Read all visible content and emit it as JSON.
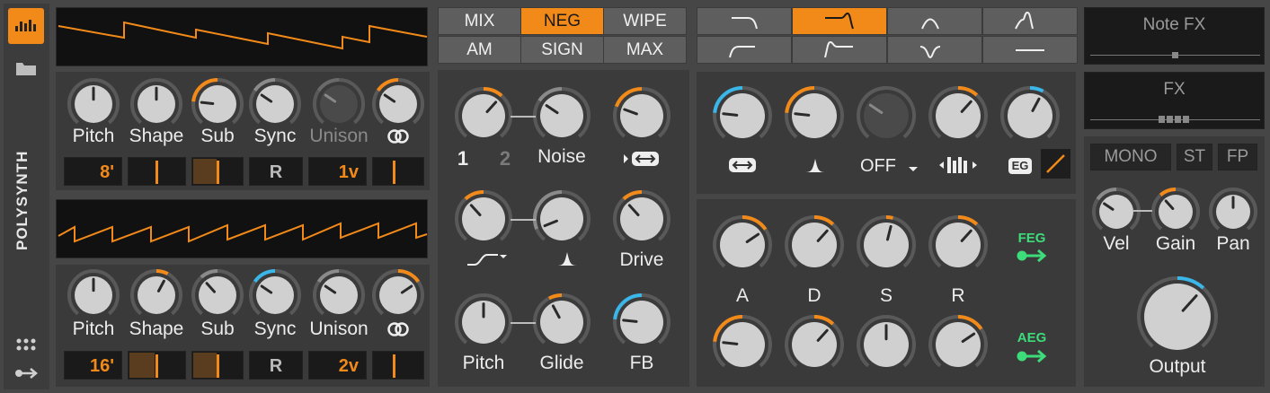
{
  "device": {
    "name": "POLYSYNTH"
  },
  "osc1": {
    "knobs": [
      {
        "label": "Pitch",
        "value": 0.5,
        "color": "#8a8a8a"
      },
      {
        "label": "Shape",
        "value": 0.5,
        "color": "#8a8a8a"
      },
      {
        "label": "Sub",
        "value": 0.2,
        "color": "#f28a1a"
      },
      {
        "label": "Sync",
        "value": 0.3,
        "color": "#8a8a8a"
      },
      {
        "label": "Unison",
        "value": 0.3,
        "color": "#6a6a6a"
      },
      {
        "label": "",
        "value": 0.3,
        "color": "#f28a1a"
      }
    ],
    "values": {
      "octave": "8'",
      "sync_mode": "R",
      "voices": "1v"
    }
  },
  "osc2": {
    "knobs": [
      {
        "label": "Pitch",
        "value": 0.5,
        "color": "#8a8a8a"
      },
      {
        "label": "Shape",
        "value": 0.6,
        "color": "#f28a1a"
      },
      {
        "label": "Sub",
        "value": 0.35,
        "color": "#8a8a8a"
      },
      {
        "label": "Sync",
        "value": 0.3,
        "color": "#3ab6e8"
      },
      {
        "label": "Unison",
        "value": 0.3,
        "color": "#8a8a8a"
      },
      {
        "label": "",
        "value": 0.7,
        "color": "#f28a1a"
      }
    ],
    "values": {
      "octave": "16'",
      "sync_mode": "R",
      "voices": "2v"
    }
  },
  "mixer": {
    "modes": [
      "MIX",
      "NEG",
      "WIPE",
      "AM",
      "SIGN",
      "MAX"
    ],
    "active_mode": "NEG",
    "knobs": [
      {
        "label": "",
        "value": 0.65,
        "color": "#f28a1a"
      },
      {
        "label": "Noise",
        "value": 0.3,
        "color": "#8a8a8a"
      },
      {
        "label": "",
        "value": 0.25,
        "color": "#f28a1a"
      },
      {
        "label": "",
        "value": 0.35,
        "color": "#f28a1a"
      },
      {
        "label": "",
        "value": 0.1,
        "color": "#8a8a8a"
      },
      {
        "label": "Drive",
        "value": 0.35,
        "color": "#f28a1a"
      },
      {
        "label": "Pitch",
        "value": 0.5,
        "color": "#8a8a8a"
      },
      {
        "label": "Glide",
        "value": 0.4,
        "color": "#f28a1a"
      },
      {
        "label": "FB",
        "value": 0.2,
        "color": "#3ab6e8"
      }
    ],
    "osc_numbers": [
      "1",
      "2"
    ]
  },
  "filter": {
    "types": [
      "lowpass",
      "lowpass-res",
      "bandpass",
      "bandpass-res",
      "highpass",
      "highpass-res",
      "notch",
      "flat"
    ],
    "active_type": "lowpass-res",
    "knobs": [
      {
        "label": "",
        "value": 0.2,
        "color": "#3ab6e8"
      },
      {
        "label": "",
        "value": 0.2,
        "color": "#f28a1a"
      },
      {
        "label": "",
        "value": 0.3,
        "color": "#5a5a5a"
      },
      {
        "label": "",
        "value": 0.65,
        "color": "#f28a1a"
      },
      {
        "label": "",
        "value": 0.6,
        "color": "#3ab6e8"
      }
    ],
    "off_label": "OFF",
    "eg_label": "EG"
  },
  "envelopes": {
    "labels": [
      "A",
      "D",
      "S",
      "R"
    ],
    "feg": {
      "label": "FEG",
      "values": [
        0.7,
        0.65,
        0.55,
        0.65
      ]
    },
    "aeg": {
      "label": "AEG",
      "values": [
        0.2,
        0.65,
        0.5,
        0.7
      ]
    }
  },
  "fx": {
    "note_fx": "Note FX",
    "fx": "FX"
  },
  "output": {
    "mono": "MONO",
    "st": "ST",
    "fp": "FP",
    "knobs": [
      {
        "label": "Vel",
        "value": 0.3,
        "color": "#8a8a8a"
      },
      {
        "label": "Gain",
        "value": 0.35,
        "color": "#f28a1a"
      },
      {
        "label": "Pan",
        "value": 0.5,
        "color": "#8a8a8a"
      }
    ],
    "output_label": "Output",
    "output_value": 0.65,
    "output_color": "#3ab6e8"
  }
}
